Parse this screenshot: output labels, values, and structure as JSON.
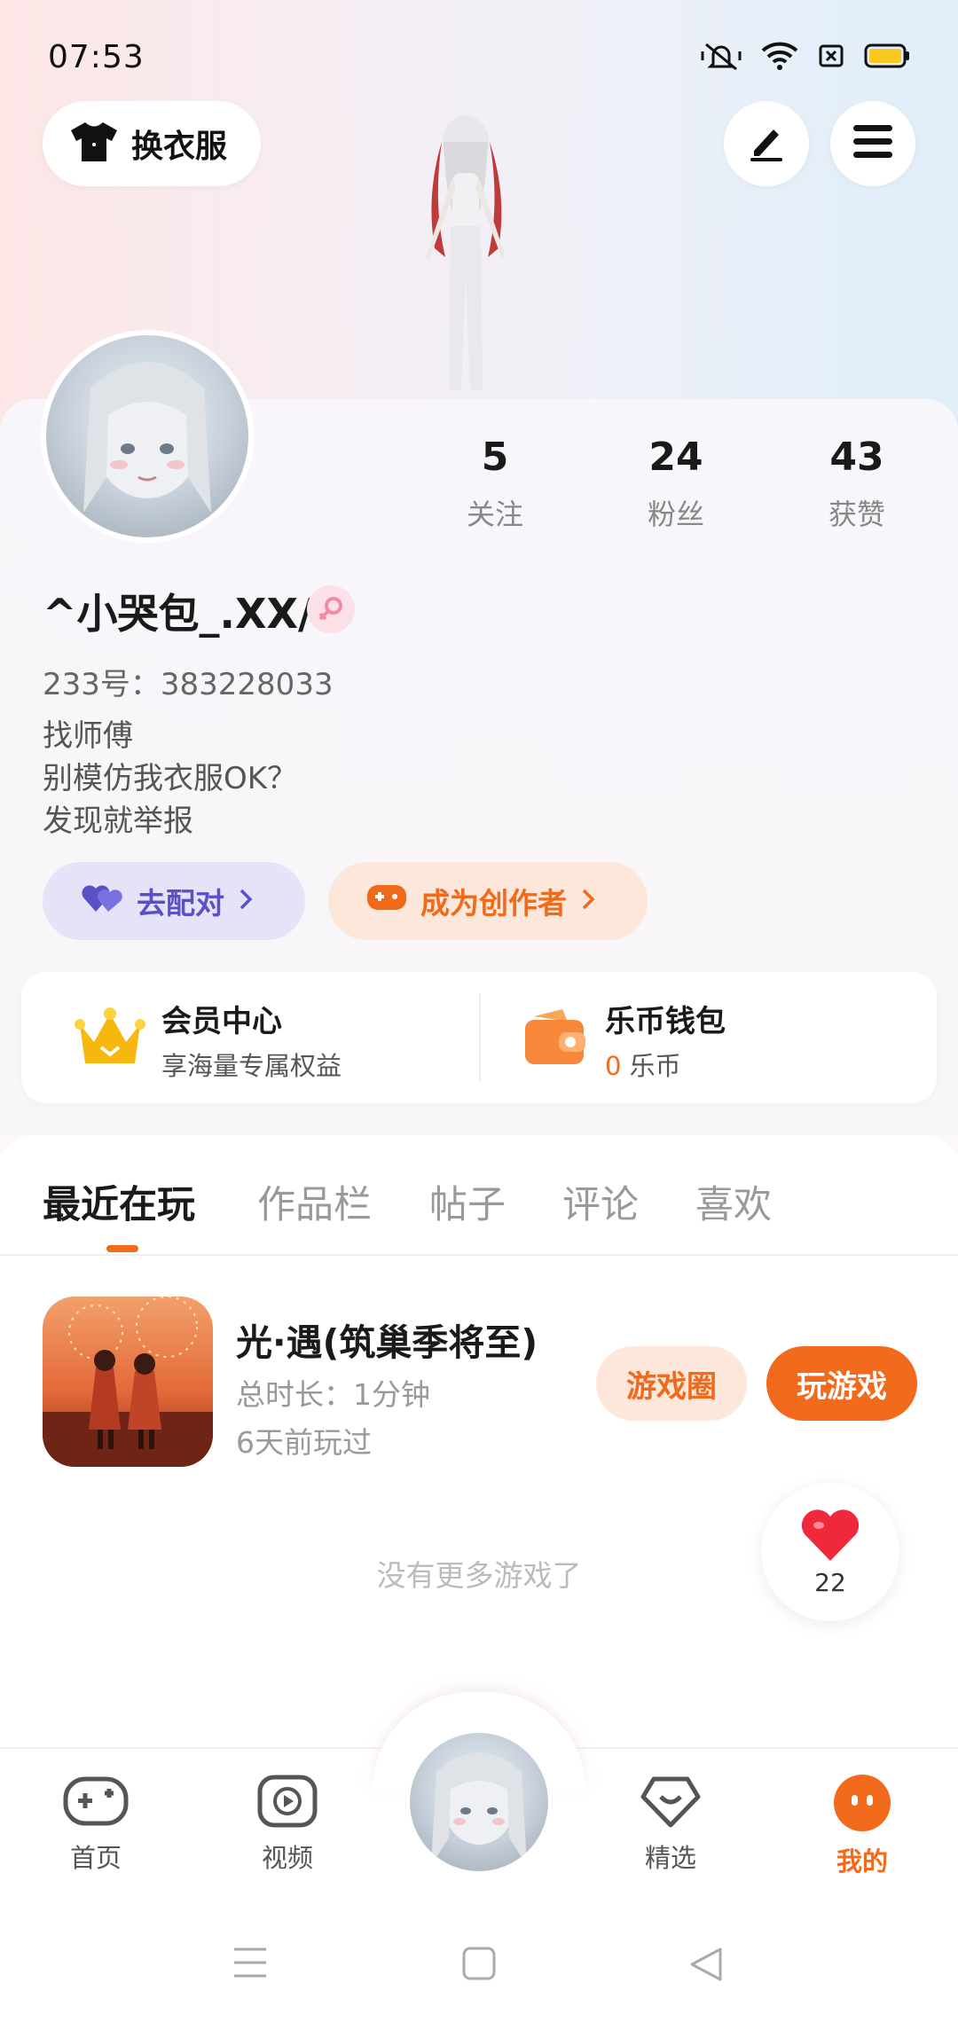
{
  "status_bar": {
    "time": "07:53"
  },
  "top": {
    "outfit_label": "换衣服"
  },
  "profile": {
    "username": "^小哭包_.XX/",
    "uid": "233号：383228033",
    "bio": [
      "找师傅",
      "别模仿我衣服OK？",
      "发现就举报"
    ],
    "stats": [
      {
        "value": "5",
        "label": "关注"
      },
      {
        "value": "24",
        "label": "粉丝"
      },
      {
        "value": "43",
        "label": "获赞"
      }
    ]
  },
  "actions": {
    "match_label": "去配对",
    "creator_label": "成为创作者"
  },
  "wallet": {
    "vip_title": "会员中心",
    "vip_sub": "享海量专属权益",
    "coin_title": "乐币钱包",
    "coin_amount": "0",
    "coin_unit": "乐币"
  },
  "tabs": [
    "最近在玩",
    "作品栏",
    "帖子",
    "评论",
    "喜欢"
  ],
  "recent_game": {
    "name": "光·遇(筑巢季将至)",
    "duration": "总时长：1分钟",
    "last_played": "6天前玩过",
    "circle_label": "游戏圈",
    "play_label": "玩游戏"
  },
  "no_more_text": "没有更多游戏了",
  "like_count": "22",
  "bottom_nav": {
    "home": "首页",
    "video": "视频",
    "featured": "精选",
    "mine": "我的"
  },
  "colors": {
    "accent": "#f26a1b",
    "match": "#5a51c8"
  }
}
